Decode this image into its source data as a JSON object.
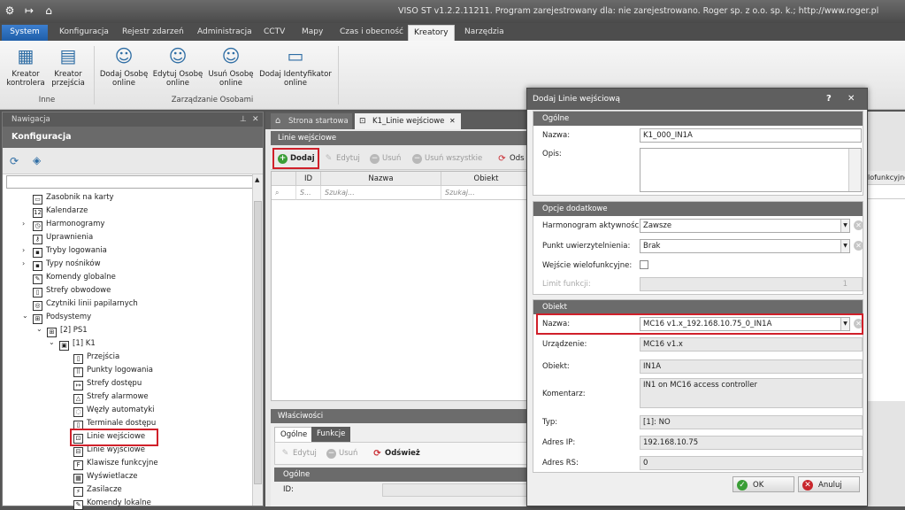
{
  "window": {
    "title": "VISO ST v1.2.2.11211. Program zarejestrowany dla: nie zarejestrowano. Roger sp. z o.o. sp. k.; http://www.roger.pl"
  },
  "ribbon": {
    "tabs": [
      "System",
      "Konfiguracja",
      "Rejestr zdarzeń",
      "Administracja",
      "CCTV",
      "Mapy",
      "Czas i obecność",
      "Kreatory",
      "Narzędzia"
    ],
    "active_tab": "Kreatory",
    "buttons": {
      "kreator_kontrolera": "Kreator kontrolera",
      "kreator_przejscia": "Kreator przejścia",
      "dodaj_osobe": "Dodaj Osobę online",
      "edytuj_osobe": "Edytuj Osobę online",
      "usun_osobe": "Usuń Osobę online",
      "dodaj_identyfikator": "Dodaj Identyfikator online"
    },
    "groups": {
      "inne": "Inne",
      "zarzadzanie": "Zarządzanie Osobami"
    }
  },
  "nav": {
    "header": "Nawigacja",
    "title": "Konfiguracja",
    "tree": [
      {
        "label": "Zasobnik na karty",
        "icon": "drawer-icon"
      },
      {
        "label": "Kalendarze",
        "icon": "calendar-icon"
      },
      {
        "label": "Harmonogramy",
        "icon": "clock-icon"
      },
      {
        "label": "Uprawnienia",
        "icon": "key-icon"
      },
      {
        "label": "Tryby logowania",
        "icon": "login-mode-icon"
      },
      {
        "label": "Typy nośników",
        "icon": "card-type-icon"
      },
      {
        "label": "Komendy globalne",
        "icon": "command-icon"
      },
      {
        "label": "Strefy obwodowe",
        "icon": "zone-icon"
      },
      {
        "label": "Czytniki linii papilarnych",
        "icon": "fingerprint-icon"
      },
      {
        "label": "Podsystemy",
        "icon": "network-icon"
      },
      {
        "label": "[2] PS1",
        "icon": "network-icon"
      },
      {
        "label": "[1] K1",
        "icon": "controller-icon"
      },
      {
        "label": "Przejścia",
        "icon": "door-icon"
      },
      {
        "label": "Punkty logowania",
        "icon": "keypad-icon"
      },
      {
        "label": "Strefy dostępu",
        "icon": "access-zone-icon"
      },
      {
        "label": "Strefy alarmowe",
        "icon": "alarm-icon"
      },
      {
        "label": "Węzły automatyki",
        "icon": "automation-icon"
      },
      {
        "label": "Terminale dostępu",
        "icon": "terminal-icon"
      },
      {
        "label": "Linie wejściowe",
        "icon": "input-line-icon"
      },
      {
        "label": "Linie wyjściowe",
        "icon": "output-line-icon"
      },
      {
        "label": "Klawisze funkcyjne",
        "icon": "function-key-icon"
      },
      {
        "label": "Wyświetlacze",
        "icon": "display-icon"
      },
      {
        "label": "Zasilacze",
        "icon": "power-icon"
      },
      {
        "label": "Komendy lokalne",
        "icon": "command-icon"
      }
    ]
  },
  "doc": {
    "tabs": [
      "Strona startowa",
      "K1_Linie wejściowe"
    ],
    "pane_title": "Linie wejściowe",
    "toolbar": {
      "dodaj": "Dodaj",
      "edytuj": "Edytuj",
      "usun": "Usuń",
      "usun_wszystkie": "Usuń wszystkie",
      "odswiez_short": "Ods"
    },
    "grid": {
      "columns": [
        "ID",
        "Nazwa",
        "Obiekt"
      ],
      "filter_placeholder_short": "S...",
      "filter_placeholder": "Szukaj...",
      "right_col_fragment": "lofunkcyjne"
    },
    "properties": {
      "title": "Właściwości",
      "tabs": [
        "Ogólne",
        "Funkcje"
      ],
      "toolbar": {
        "edytuj": "Edytuj",
        "usun": "Usuń",
        "odswiez": "Odśwież"
      },
      "section": "Ogólne",
      "id_label": "ID:"
    }
  },
  "dialog": {
    "title": "Dodaj Linie wejściową",
    "help": "?",
    "close": "✕",
    "ogolne": {
      "header": "Ogólne",
      "nazwa_label": "Nazwa:",
      "nazwa_value": "K1_000_IN1A",
      "opis_label": "Opis:",
      "opis_value": ""
    },
    "opcje": {
      "header": "Opcje dodatkowe",
      "harmonogram_label": "Harmonogram aktywności:",
      "harmonogram_value": "Zawsze",
      "punkt_label": "Punkt uwierzytelnienia:",
      "punkt_value": "Brak",
      "wielofunkcyjne_label": "Wejście wielofunkcyjne:",
      "limit_label": "Limit funkcji:",
      "limit_value": "1"
    },
    "obiekt": {
      "header": "Obiekt",
      "nazwa_label": "Nazwa:",
      "nazwa_value": "MC16 v1.x_192.168.10.75_0_IN1A",
      "urzadzenie_label": "Urządzenie:",
      "urzadzenie_value": "MC16 v1.x",
      "obiekt_label": "Obiekt:",
      "obiekt_value": "IN1A",
      "komentarz_label": "Komentarz:",
      "komentarz_value": "IN1 on MC16 access controller",
      "typ_label": "Typ:",
      "typ_value": "[1]: NO",
      "adres_ip_label": "Adres IP:",
      "adres_ip_value": "192.168.10.75",
      "adres_rs_label": "Adres RS:",
      "adres_rs_value": "0"
    },
    "buttons": {
      "ok": "OK",
      "anuluj": "Anuluj"
    }
  },
  "colors": {
    "highlight": "#d0202a",
    "ok_green": "#3a9e36",
    "cancel_red": "#c8262c",
    "system_blue": "#1f5ea8"
  }
}
